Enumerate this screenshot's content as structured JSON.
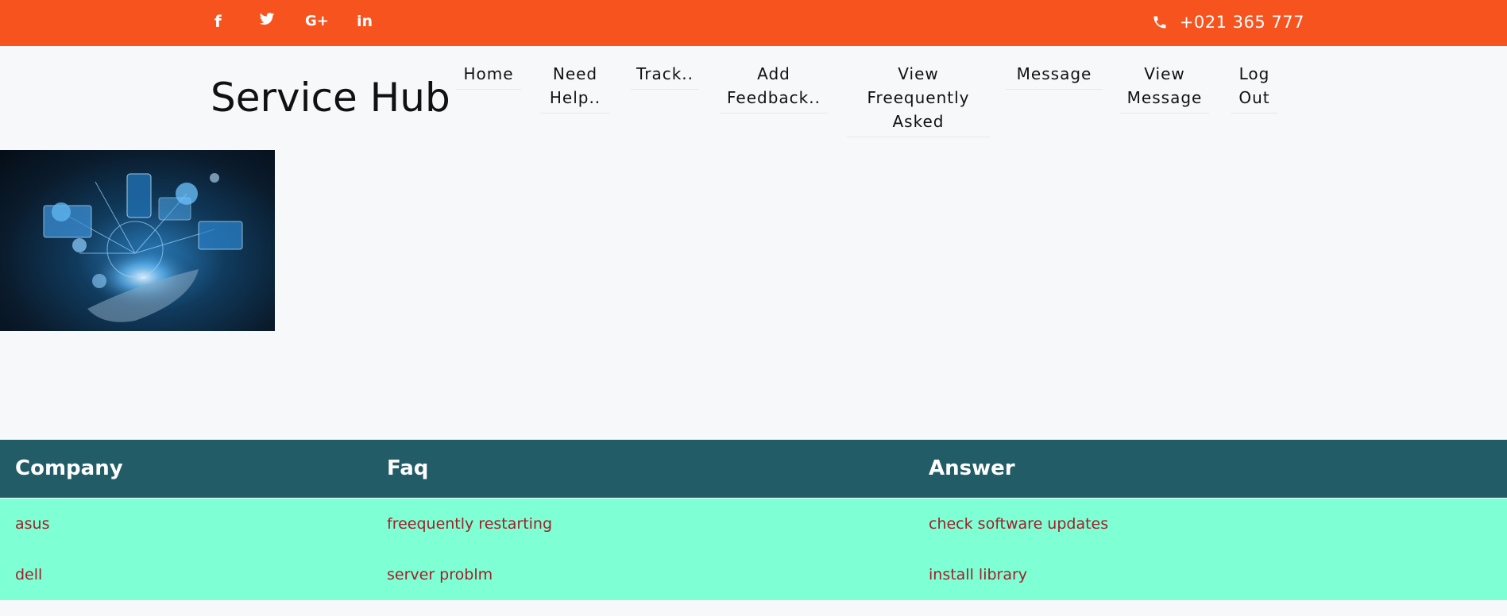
{
  "topbar": {
    "social": [
      {
        "icon": "facebook-icon",
        "glyph": "f"
      },
      {
        "icon": "twitter-icon",
        "glyph": "🐦"
      },
      {
        "icon": "google-plus-icon",
        "glyph": "G+"
      },
      {
        "icon": "linkedin-icon",
        "glyph": "in"
      }
    ],
    "phone_icon": "📞",
    "phone": "+021 365 777",
    "color": "#f7531f"
  },
  "brand": "Service Hub",
  "nav": [
    {
      "label": "Home"
    },
    {
      "label": "Need Help.."
    },
    {
      "label": "Track.."
    },
    {
      "label": "Add Feedback.."
    },
    {
      "label": "View Freequently Asked"
    },
    {
      "label": "Message"
    },
    {
      "label": "View Message"
    },
    {
      "label": "Log Out"
    }
  ],
  "table": {
    "headers": [
      "Company",
      "Faq",
      "Answer"
    ],
    "rows": [
      [
        "asus",
        "freequently restarting",
        "check software updates"
      ],
      [
        "dell",
        "server problm",
        "install library"
      ]
    ],
    "header_color": "#215c67",
    "body_color": "#7fffd4",
    "text_color": "#a0202a"
  }
}
